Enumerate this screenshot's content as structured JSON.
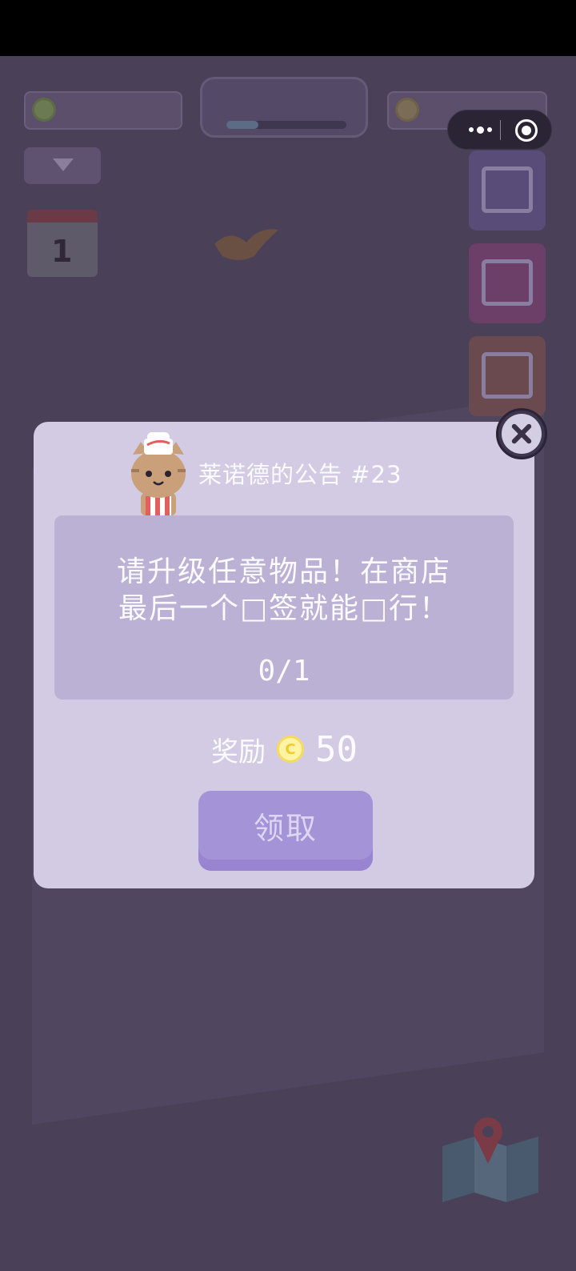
{
  "dialog": {
    "title": "莱诺德的公告 #23",
    "message_line1": "请升级任意物品！在商店",
    "message_line2": "最后一个□签就能□行！",
    "progress": "0/1",
    "reward_label": "奖励",
    "reward_coin_symbol": "C",
    "reward_amount": "50",
    "claim_label": "领取"
  },
  "icons": {
    "close": "close-icon",
    "coin": "coin-icon",
    "cat": "cat-chef-avatar",
    "more": "more-dots-icon",
    "capsule_close": "target-circle-icon"
  },
  "colors": {
    "dialog_bg": "#d2cbe3",
    "panel_bg": "#bbb1d4",
    "button_bg": "#a593d8",
    "overlay_bg": "#463e56"
  }
}
